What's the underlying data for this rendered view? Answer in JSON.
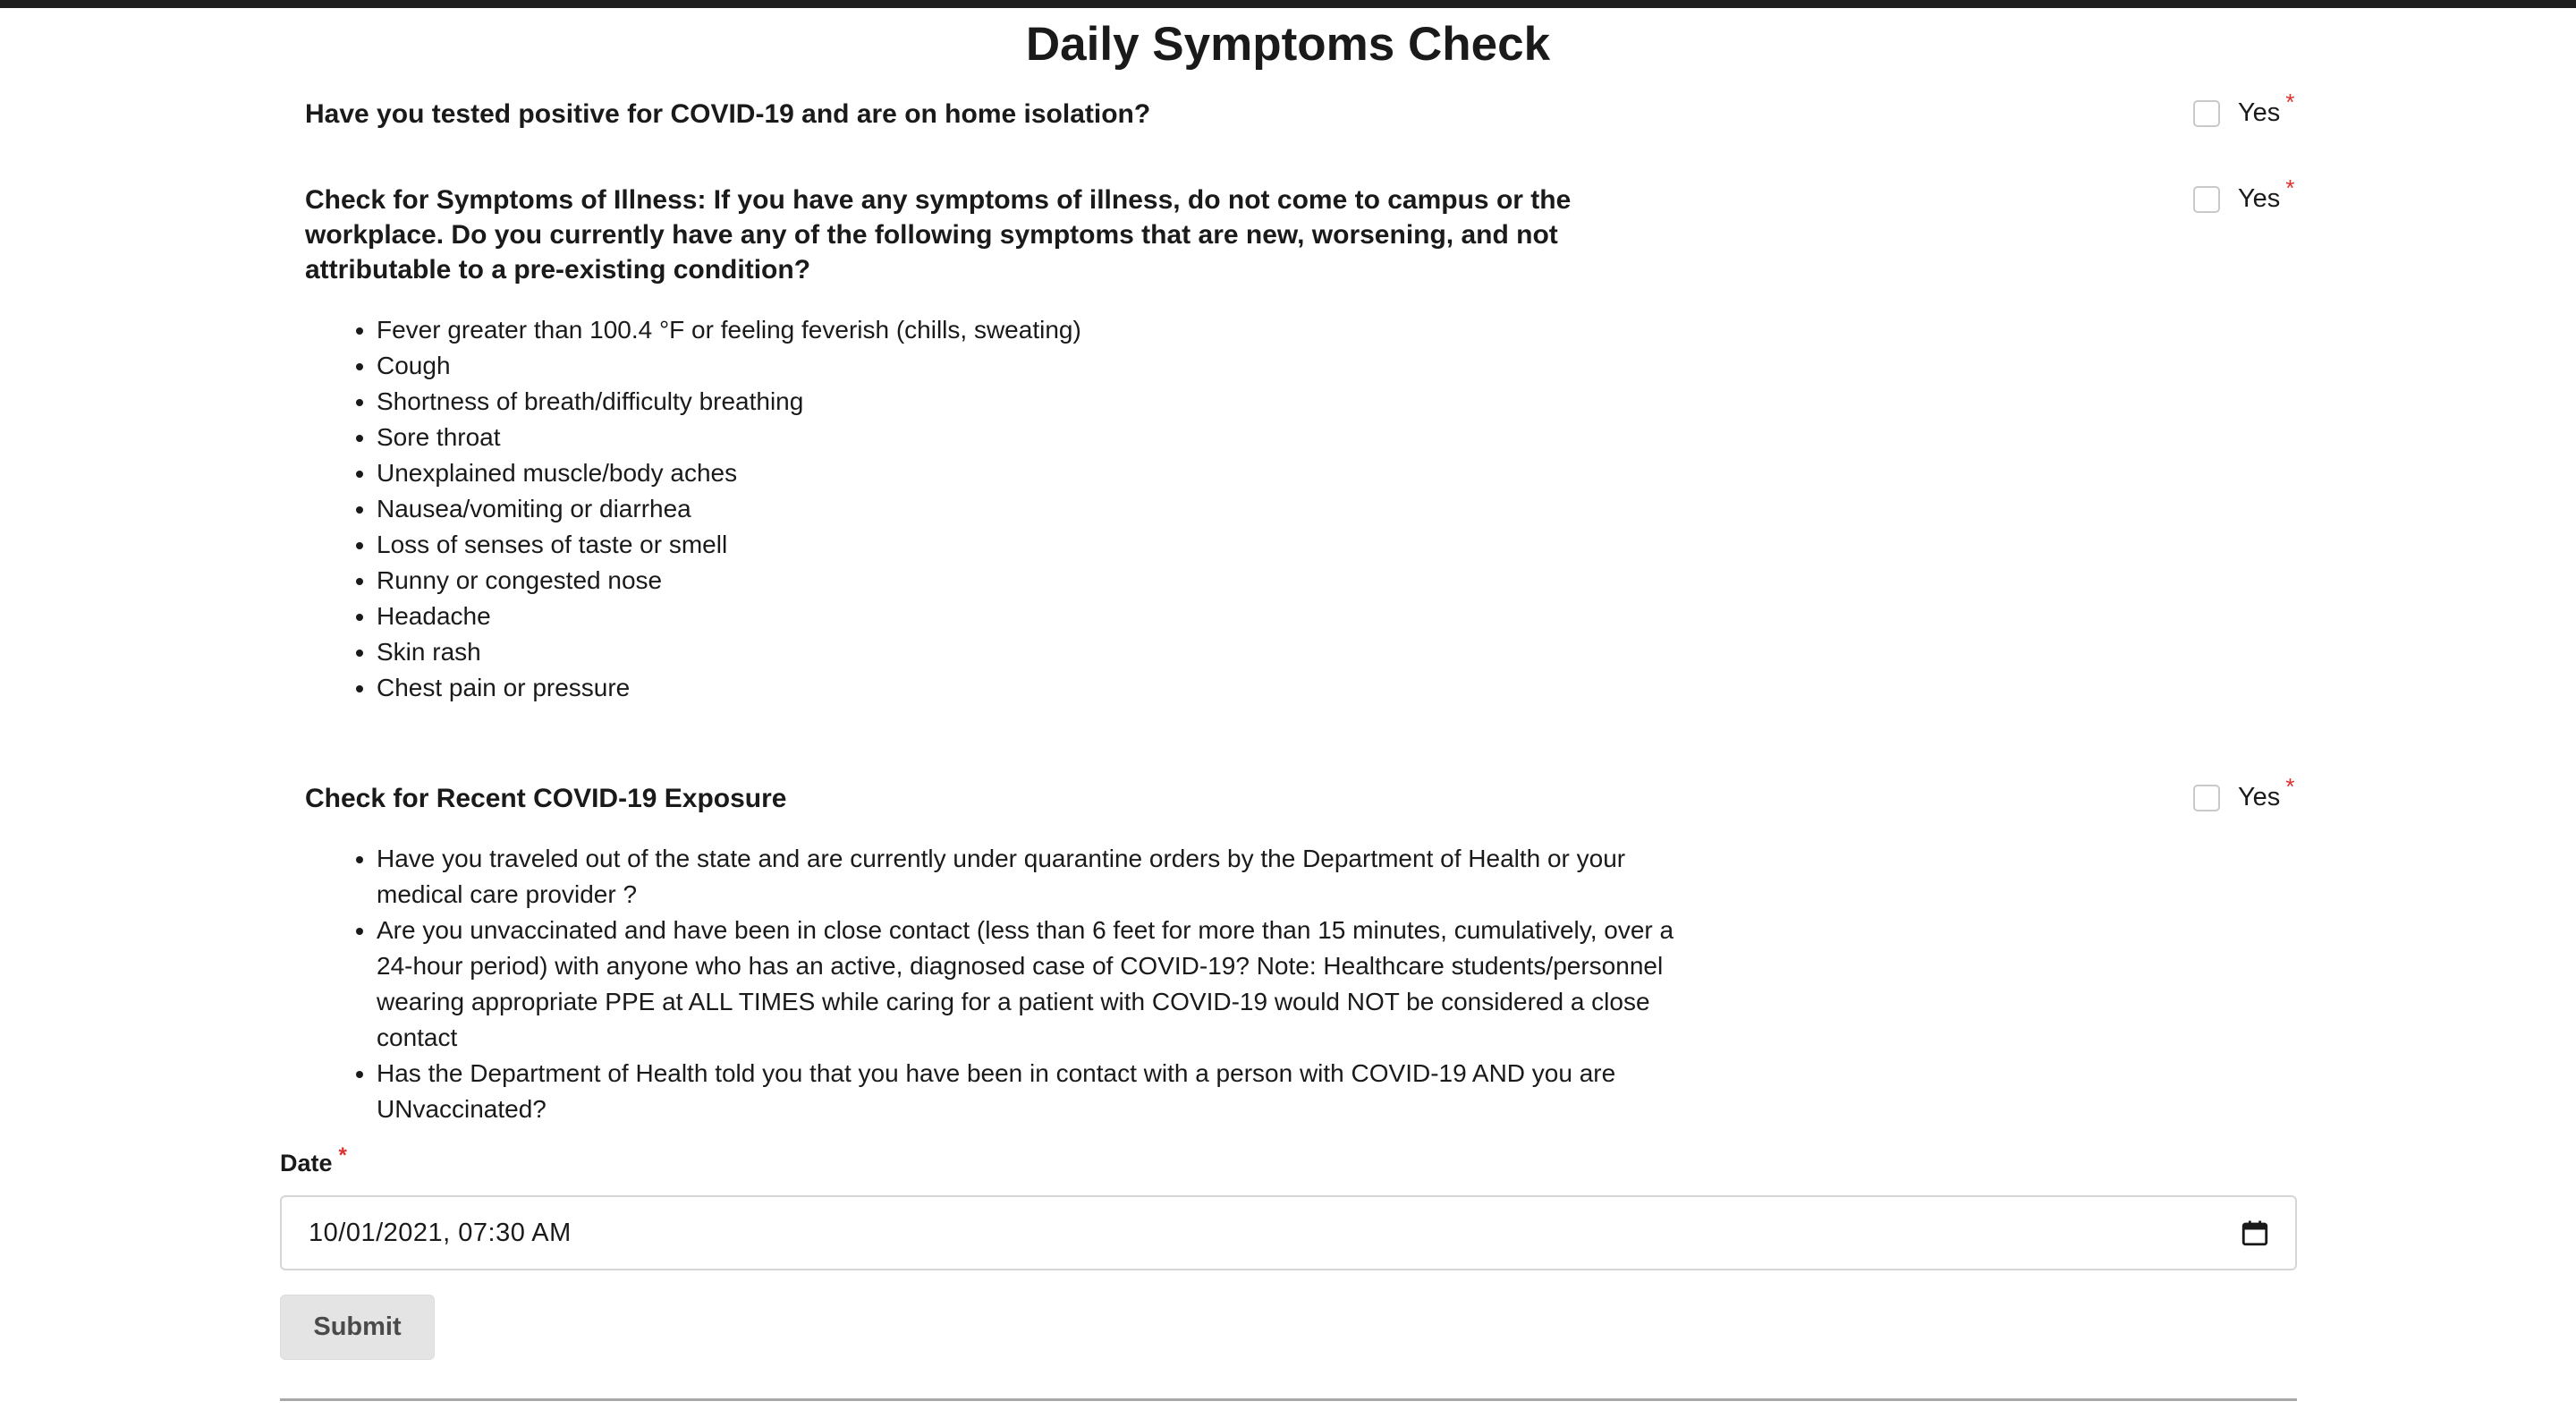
{
  "page": {
    "title": "Daily Symptoms Check"
  },
  "questions": [
    {
      "text": "Have you tested positive for COVID-19 and are on home isolation?",
      "option_label": "Yes",
      "required_mark": "*"
    },
    {
      "text_lines": [
        "Check for Symptoms of Illness: If you have any symptoms of illness, do not come to campus or the",
        "workplace. Do you currently have any of the following symptoms that are new, worsening, and not",
        "attributable to a pre-existing condition?"
      ],
      "option_label": "Yes",
      "required_mark": "*",
      "symptoms": [
        "Fever greater than 100.4 °F or feeling feverish (chills, sweating)",
        "Cough",
        "Shortness of breath/difficulty breathing",
        "Sore throat",
        "Unexplained muscle/body aches",
        "Nausea/vomiting or diarrhea",
        "Loss of senses of taste or smell",
        "Runny or congested nose",
        "Headache",
        "Skin rash",
        "Chest pain or pressure"
      ]
    },
    {
      "text": "Check for Recent COVID-19 Exposure",
      "option_label": "Yes",
      "required_mark": "*",
      "exposure_items": [
        {
          "lines": [
            "Have you traveled out of the state and are currently under quarantine orders by the Department of Health or your",
            "medical care provider ?"
          ]
        },
        {
          "lines": [
            "Are you unvaccinated and have been in close contact (less than 6 feet for more than 15 minutes, cumulatively, over a",
            "24-hour period) with anyone who has an active, diagnosed case of COVID-19? Note: Healthcare students/personnel",
            "wearing appropriate PPE at ALL TIMES while caring for a patient with COVID-19 would NOT be considered a close",
            "contact"
          ]
        },
        {
          "lines": [
            "Has the Department of Health told you that you have been in contact with a person with COVID-19 AND you are",
            "UNvaccinated?"
          ]
        }
      ]
    }
  ],
  "date_field": {
    "label": "Date",
    "required_mark": "*",
    "value": "10/01/2021, 07:30 AM",
    "icon": "calendar-icon"
  },
  "submit": {
    "label": "Submit"
  }
}
